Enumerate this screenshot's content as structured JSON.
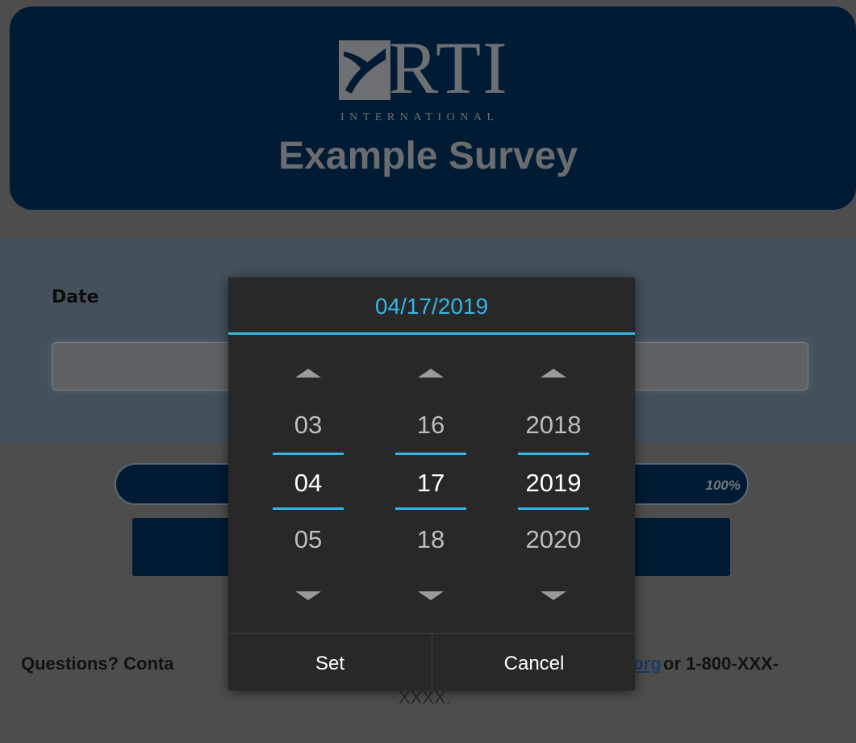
{
  "header": {
    "logo_text": "RTI",
    "logo_subtext": "INTERNATIONAL",
    "survey_title": "Example Survey"
  },
  "question": {
    "label": "Date",
    "input_value": ""
  },
  "progress": {
    "text": "100%",
    "fraction": 1.0
  },
  "footer": {
    "prefix": "Questions? Conta",
    "link_text": "i.org",
    "suffix": " or 1-800-XXX-",
    "continuation": "XXXX."
  },
  "date_picker": {
    "title": "04/17/2019",
    "month": {
      "prev": "03",
      "current": "04",
      "next": "05"
    },
    "day": {
      "prev": "16",
      "current": "17",
      "next": "18"
    },
    "year": {
      "prev": "2018",
      "current": "2019",
      "next": "2020"
    },
    "set_label": "Set",
    "cancel_label": "Cancel"
  },
  "colors": {
    "accent": "#33b5e5",
    "header_bg": "#001b33",
    "dialog_bg": "#282828"
  },
  "icons": [
    "arrow-up-icon",
    "arrow-down-icon",
    "rti-logo-mark"
  ]
}
